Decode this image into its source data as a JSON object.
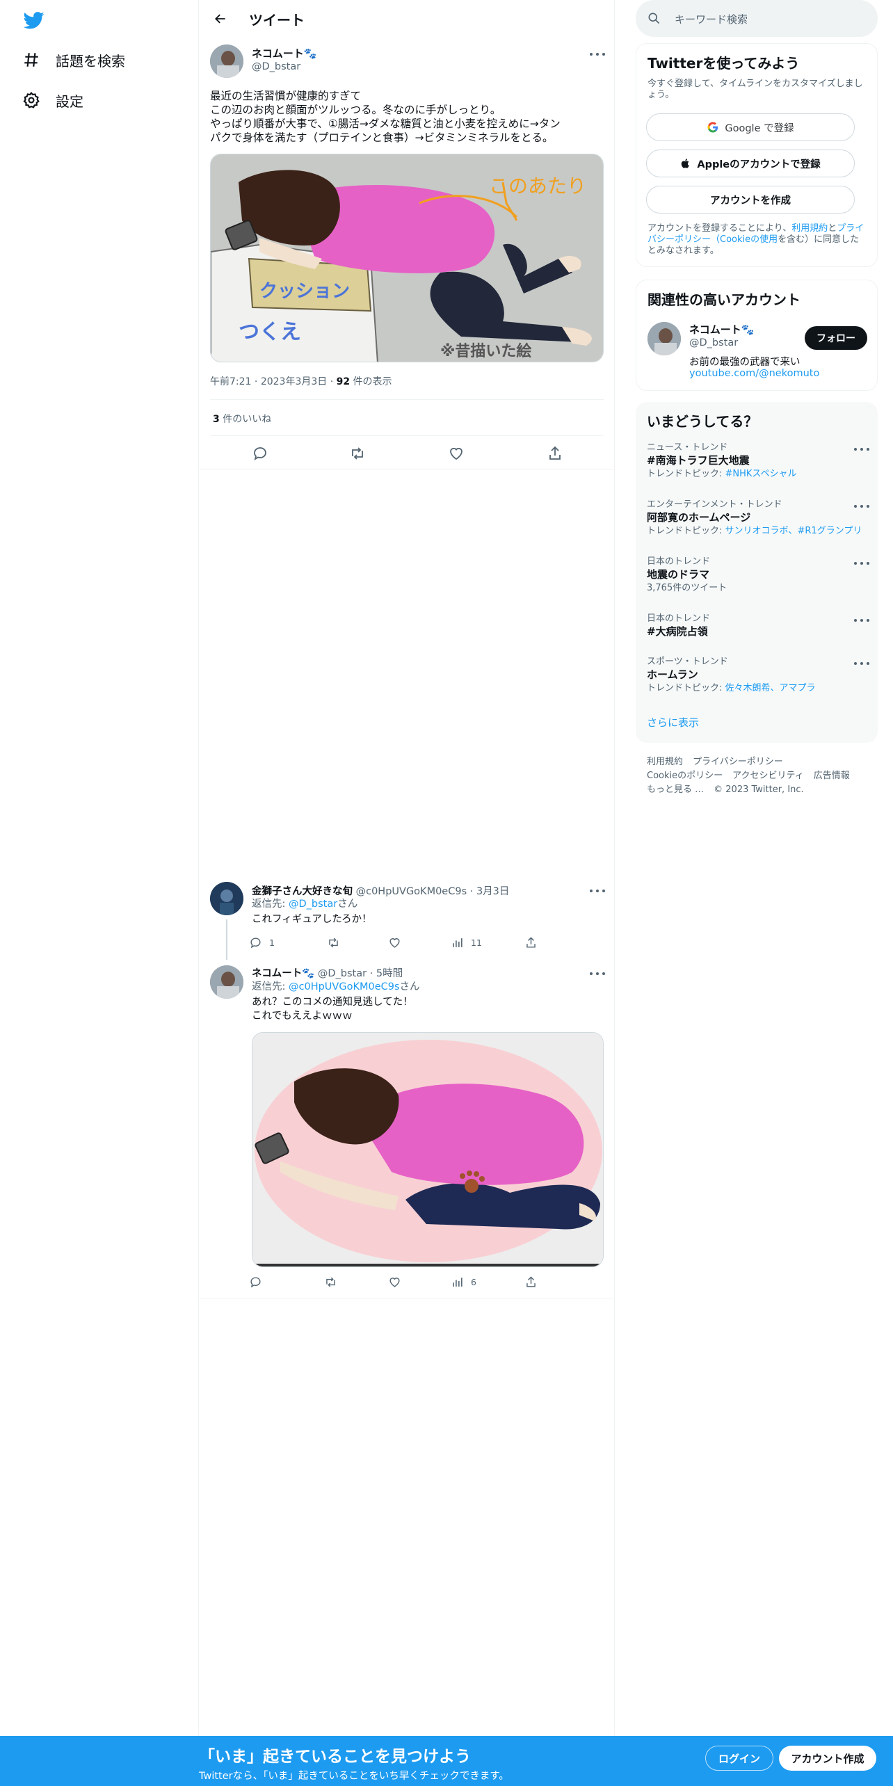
{
  "nav": {
    "items": [
      {
        "label": "話題を検索"
      },
      {
        "label": "設定"
      }
    ]
  },
  "header": {
    "title": "ツイート"
  },
  "main_tweet": {
    "author_name": "ネコムート🐾",
    "author_handle": "@D_bstar",
    "lines": [
      "最近の生活習慣が健康的すぎて",
      "この辺のお肉と顔面がツルッつる。冬なのに手がしっとり。",
      "やっぱり順番が大事で、①腸活→ダメな糖質と油と小麦を控えめに→タン",
      "パクで身体を満たす（プロテインと食事）→ビタミンミネラルをとる。"
    ],
    "image_text": {
      "annotation": "このあたり",
      "cushion": "クッション",
      "desk": "つくえ",
      "note": "※昔描いた絵"
    },
    "time": "午前7:21",
    "date": "2023年3月3日",
    "views_count": "92",
    "views_label": " 件の表示",
    "likes_count": "3",
    "likes_label": " 件のいいね"
  },
  "replies": [
    {
      "author_name": "金獅子さん大好きな旬",
      "author_handle": "@c0HpUVGoKM0eC9s",
      "time": "3月3日",
      "reply_to_prefix": "返信先: ",
      "reply_to": "@D_bstar",
      "reply_to_suffix": "さん",
      "lines": [
        "これフィギュアしたろか！"
      ],
      "reply_count": "1",
      "views": "11"
    },
    {
      "author_name": "ネコムート🐾",
      "author_handle": "@D_bstar",
      "time": "5時間",
      "reply_to_prefix": "返信先: ",
      "reply_to": "@c0HpUVGoKM0eC9s",
      "reply_to_suffix": "さん",
      "lines": [
        "あれ？このコメの通知見逃してた！",
        "これでもええよｗｗｗ"
      ],
      "views": "6"
    }
  ],
  "search": {
    "placeholder": "キーワード検索"
  },
  "signup_card": {
    "title": "Twitterを使ってみよう",
    "desc": "今すぐ登録して、タイムラインをカスタマイズしましょう。",
    "google": "Google で登録",
    "apple": "Appleのアカウントで登録",
    "create": "アカウントを作成",
    "terms_prefix": "アカウントを登録することにより、",
    "terms_link1": "利用規約",
    "terms_mid": "と",
    "terms_link2": "プライバシーポリシー（Cookieの使用",
    "terms_suffix": "を含む）に同意したとみなされます。"
  },
  "related_card": {
    "title": "関連性の高いアカウント",
    "name": "ネコムート🐾",
    "handle": "@D_bstar",
    "bio": "お前の最強の武器で来い",
    "link": "youtube.com/@nekomuto",
    "follow": "フォロー"
  },
  "trends_card": {
    "title": "いまどうしてる？",
    "items": [
      {
        "category": "ニュース・トレンド",
        "name": "#南海トラフ巨大地震",
        "sub_prefix": "トレンドトピック: ",
        "sub_links": "#NHKスペシャル"
      },
      {
        "category": "エンターテインメント・トレンド",
        "name": "阿部寛のホームページ",
        "sub_prefix": "トレンドトピック: ",
        "sub_links": "サンリオコラボ、#R1グランプリ"
      },
      {
        "category": "日本のトレンド",
        "name": "地震のドラマ",
        "sub_prefix": "3,765件のツイート",
        "sub_links": ""
      },
      {
        "category": "日本のトレンド",
        "name": "#大病院占領",
        "sub_prefix": "",
        "sub_links": ""
      },
      {
        "category": "スポーツ・トレンド",
        "name": "ホームラン",
        "sub_prefix": "トレンドトピック: ",
        "sub_links": "佐々木朗希、アマプラ"
      }
    ],
    "show_more": "さらに表示"
  },
  "footer": {
    "links": [
      "利用規約",
      "プライバシーポリシー",
      "Cookieのポリシー",
      "アクセシビリティ",
      "広告情報",
      "もっと見る …",
      "© 2023 Twitter, Inc."
    ]
  },
  "bottom_bar": {
    "title": "「いま」起きていることを見つけよう",
    "subtitle": "Twitterなら、「いま」起きていることをいち早くチェックできます。",
    "login": "ログイン",
    "signup": "アカウント作成"
  },
  "colors": {
    "accent": "#1d9bf0",
    "text": "#0f1419",
    "muted": "#536471",
    "border": "#eff3f4"
  }
}
